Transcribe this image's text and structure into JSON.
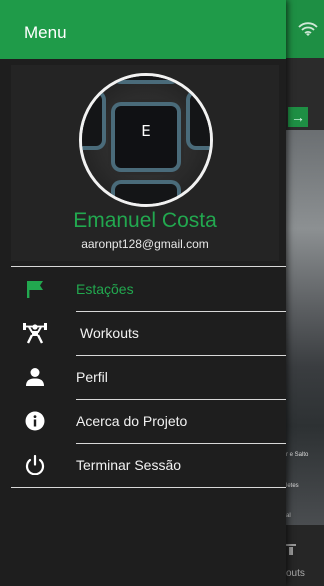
{
  "drawer": {
    "title": "Menu",
    "profile": {
      "avatar_letter": "E",
      "name": "Emanuel Costa",
      "email": "aaronpt128@gmail.com"
    },
    "items": [
      {
        "label": "Estações",
        "icon": "flag-icon",
        "active": true
      },
      {
        "label": "Workouts",
        "icon": "weightlifting-icon",
        "active": false
      },
      {
        "label": "Perfil",
        "icon": "person-icon",
        "active": false
      },
      {
        "label": "Acerca do Projeto",
        "icon": "info-icon",
        "active": false
      },
      {
        "label": "Terminar Sessão",
        "icon": "power-icon",
        "active": false
      }
    ]
  },
  "background": {
    "photo_caption_1": "r e Salto",
    "photo_caption_2": "letes",
    "photo_caption_3": "al",
    "bottom_tab_label": "outs"
  },
  "colors": {
    "accent": "#1f9b49",
    "accent_text": "#22a84f",
    "drawer_bg": "#1e1e1e",
    "profile_bg": "#242424"
  }
}
